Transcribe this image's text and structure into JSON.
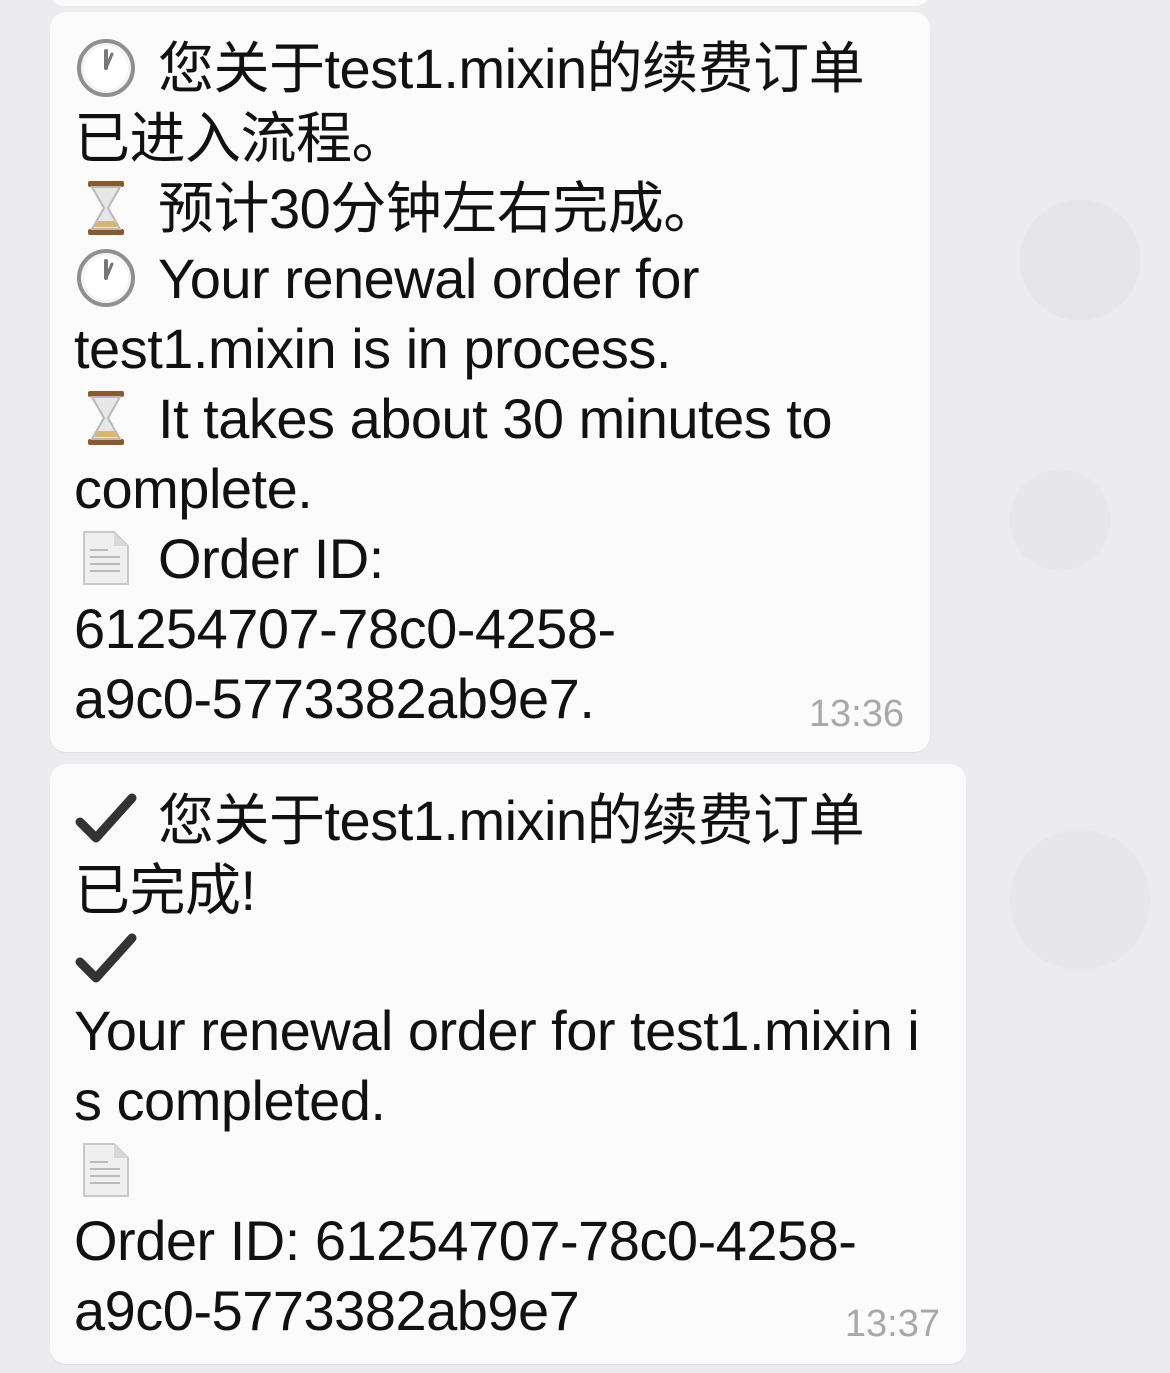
{
  "messages": [
    {
      "lines": [
        {
          "icon": "clock-icon",
          "text": "您关于test1.mixin的续费订单"
        },
        {
          "icon": null,
          "text": "已进入流程。"
        },
        {
          "icon": "hourglass-icon",
          "text": "预计30分钟左右完成。"
        },
        {
          "icon": "clock-icon",
          "text": "Your renewal order for"
        },
        {
          "icon": null,
          "text": "test1.mixin is in process."
        },
        {
          "icon": "hourglass-icon",
          "text": "It takes about 30 minutes to"
        },
        {
          "icon": null,
          "text": "complete."
        },
        {
          "icon": "document-icon",
          "text": "Order ID:"
        },
        {
          "icon": null,
          "text": "61254707-78c0-4258-"
        },
        {
          "icon": null,
          "text": "a9c0-5773382ab9e7."
        }
      ],
      "time": "13:36"
    },
    {
      "lines": [
        {
          "icon": "checkmark-icon",
          "text": "您关于test1.mixin的续费订单"
        },
        {
          "icon": null,
          "text": "已完成!"
        },
        {
          "icon": "checkmark-icon",
          "text": ""
        },
        {
          "icon": null,
          "text": "Your renewal order for test1.mixin i"
        },
        {
          "icon": null,
          "text": "s completed."
        },
        {
          "icon": "document-icon",
          "text": ""
        },
        {
          "icon": null,
          "text": "Order ID: 61254707-78c0-4258-"
        },
        {
          "icon": null,
          "text": "a9c0-5773382ab9e7"
        }
      ],
      "time": "13:37"
    }
  ],
  "colors": {
    "background": "#ececee",
    "bubble": "#fbfbfb",
    "text": "#111111",
    "timestamp": "#a8a8ab"
  }
}
